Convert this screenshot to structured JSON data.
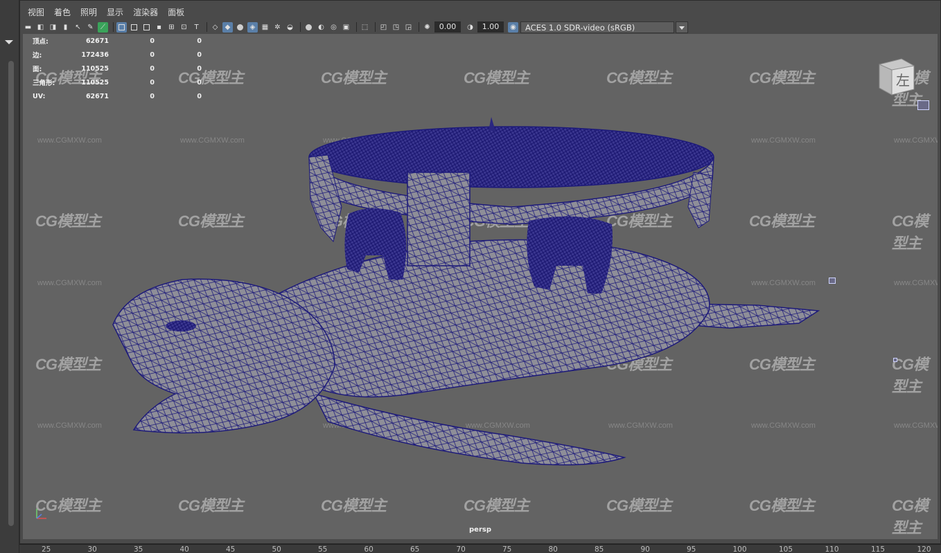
{
  "menu": {
    "items": [
      "视图",
      "着色",
      "照明",
      "显示",
      "渲染器",
      "面板"
    ]
  },
  "toolbar": {
    "field_a": "0.00",
    "field_b": "1.00",
    "color_space": "ACES 1.0 SDR-video (sRGB)"
  },
  "hud": {
    "rows": [
      {
        "label": "顶点:",
        "v1": "62671",
        "v2": "0",
        "v3": "0"
      },
      {
        "label": "边:",
        "v1": "172436",
        "v2": "0",
        "v3": "0"
      },
      {
        "label": "面:",
        "v1": "110525",
        "v2": "0",
        "v3": "0"
      },
      {
        "label": "三角形:",
        "v1": "110525",
        "v2": "0",
        "v3": "0"
      },
      {
        "label": "UV:",
        "v1": "62671",
        "v2": "0",
        "v3": "0"
      }
    ]
  },
  "viewcube": {
    "face_label": "左"
  },
  "viewport": {
    "camera": "persp"
  },
  "watermark": {
    "logo": "CG模型主",
    "url": "www.CGMXW.com"
  },
  "timeline": {
    "ticks": [
      "25",
      "30",
      "35",
      "40",
      "45",
      "50",
      "55",
      "60",
      "65",
      "70",
      "75",
      "80",
      "85",
      "90",
      "95",
      "100",
      "105",
      "110",
      "115",
      "120"
    ]
  },
  "colors": {
    "wire": "#1d1a7a",
    "viewport_bg": "#636363",
    "mesh_fill": "#8c8c94"
  }
}
